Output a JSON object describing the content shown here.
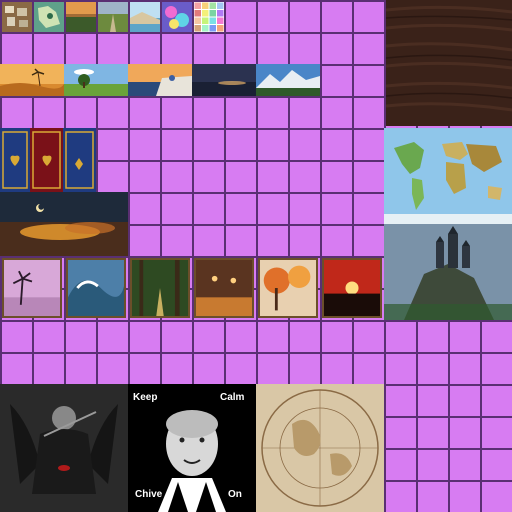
{
  "atlas": {
    "grid_cell": "32px",
    "background_color": "#d77cf2",
    "grid_line_color": "#5a2f73"
  },
  "tiles": {
    "icons_row": [
      "corkboard-icon",
      "map-icon",
      "landscape-icon",
      "road-icon",
      "coastline-icon",
      "colorful-blur-icon",
      "color-grid-icon"
    ],
    "wood_panel": "wood-texture",
    "landscapes": [
      "desert-palm",
      "green-field-tree",
      "santorini-sunset",
      "night-sea",
      "snowy-mountain"
    ],
    "banners": [
      "blue-banner",
      "red-banner",
      "blue-banner-2"
    ],
    "night_sky": "moonlit-clouds",
    "world_map": "world-map",
    "paintings": [
      "palm-sunset",
      "ocean-wave",
      "forest-path",
      "autumn-street",
      "autumn-trees",
      "red-sunset"
    ],
    "castle": "cliff-castle",
    "reaper": "grim-reaper-flute",
    "old_map": "antique-map"
  },
  "meme": {
    "top_left": "Keep",
    "top_right": "Calm",
    "bottom_left": "Chive",
    "bottom_right": "On"
  }
}
